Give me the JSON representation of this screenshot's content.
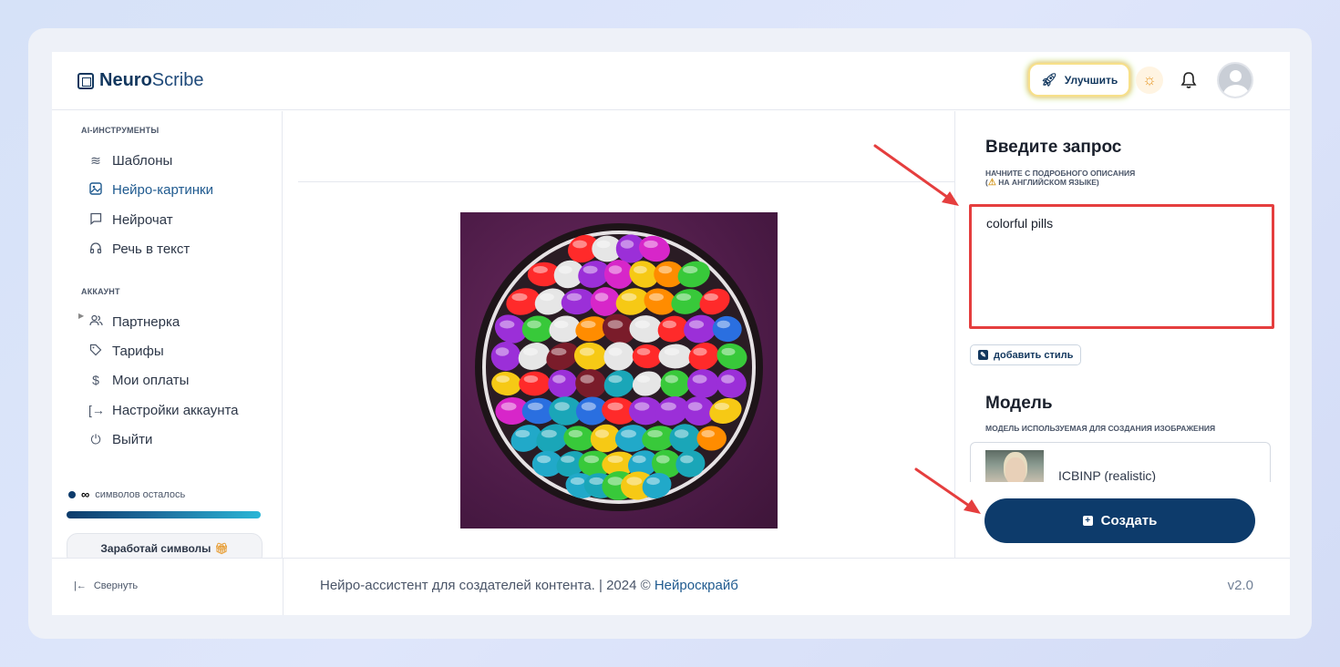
{
  "header": {
    "logo_bold": "Neuro",
    "logo_light": "Scribe",
    "upgrade_label": "Улучшить",
    "icons": {
      "upgrade": "rocket-icon",
      "theme": "sun-icon",
      "notifications": "bell-icon",
      "avatar": "user-avatar"
    }
  },
  "sidebar": {
    "tools_title": "AI-ИНСТРУМЕНТЫ",
    "tools": [
      {
        "label": "Шаблоны",
        "icon": "layers-icon"
      },
      {
        "label": "Нейро-картинки",
        "icon": "image-icon",
        "active": true
      },
      {
        "label": "Нейрочат",
        "icon": "chat-icon"
      },
      {
        "label": "Речь в текст",
        "icon": "headphones-icon"
      }
    ],
    "account_title": "АККАУНТ",
    "account": [
      {
        "label": "Партнерка",
        "icon": "users-icon"
      },
      {
        "label": "Тарифы",
        "icon": "tag-icon"
      },
      {
        "label": "Мои оплаты",
        "icon": "dollar-icon"
      },
      {
        "label": "Настройки аккаунта",
        "icon": "logout-arrow-icon"
      },
      {
        "label": "Выйти",
        "icon": "power-icon"
      }
    ],
    "symbols_value": "∞",
    "symbols_label": "символов осталось",
    "earn_label": "Заработай символы",
    "collapse_label": "Свернуть"
  },
  "panel": {
    "prompt_title": "Введите запрос",
    "prompt_sub_1": "НАЧНИТЕ С ПОДРОБНОГО ОПИСАНИЯ",
    "prompt_sub_2": "НА АНГЛИЙСКОМ ЯЗЫКЕ)",
    "prompt_value": "colorful pills",
    "add_style_label": "добавить стиль",
    "model_title": "Модель",
    "model_sub": "МОДЕЛЬ ИСПОЛЬЗУЕМАЯ ДЛЯ СОЗДАНИЯ ИЗОБРАЖЕНИЯ",
    "model_name": "ICBINP (realistic)",
    "create_label": "Создать"
  },
  "footer": {
    "text": "Нейро-ассистент для создателей контента.  | 2024 © ",
    "link": "Нейроскрайб",
    "version": "v2.0"
  },
  "colors": {
    "brand": "#0d3b6b",
    "accent_link": "#1f5a8f",
    "annotation_red": "#e53e3e"
  }
}
